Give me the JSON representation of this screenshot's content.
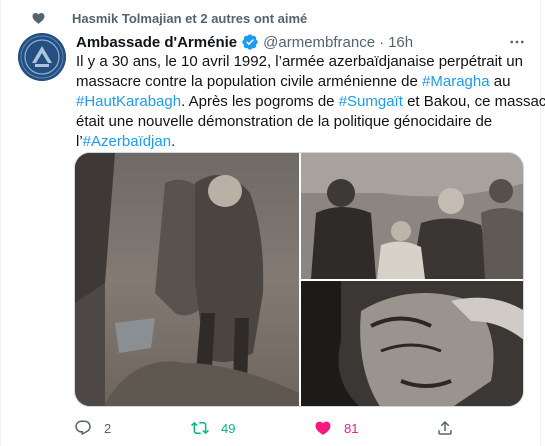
{
  "social_context": {
    "text": "Hasmik Tolmajian et 2 autres ont aimé",
    "icon": "heart-icon"
  },
  "author": {
    "name": "Ambassade d'Arménie",
    "handle": "@armembfrance",
    "separator": "·",
    "time": "16h",
    "verified": true
  },
  "tweet": {
    "lines": [
      [
        {
          "t": "Il y a 30 ans, le 10 avril 1992, l’armée azerbaïdjanaise perpétrait un"
        }
      ],
      [
        {
          "t": "massacre contre la population civile arménienne de "
        },
        {
          "tag": "#Maragha"
        },
        {
          "t": " au"
        }
      ],
      [
        {
          "tag": "#HautKarabagh"
        },
        {
          "t": ". Après les pogroms de "
        },
        {
          "tag": "#Sumgaït"
        },
        {
          "t": " et Bakou, ce massacre"
        }
      ],
      [
        {
          "t": "était une nouvelle démonstration de la politique génocidaire de"
        }
      ],
      [
        {
          "t": "l’"
        },
        {
          "tag": "#Azerbaïdjan"
        },
        {
          "t": "."
        }
      ]
    ]
  },
  "actions": {
    "reply_count": "2",
    "retweet_count": "49",
    "like_count": "81"
  },
  "colors": {
    "accent": "#1d9bf0",
    "retweet": "#00ba7c",
    "like": "#f91880",
    "secondary_text": "#536471"
  }
}
